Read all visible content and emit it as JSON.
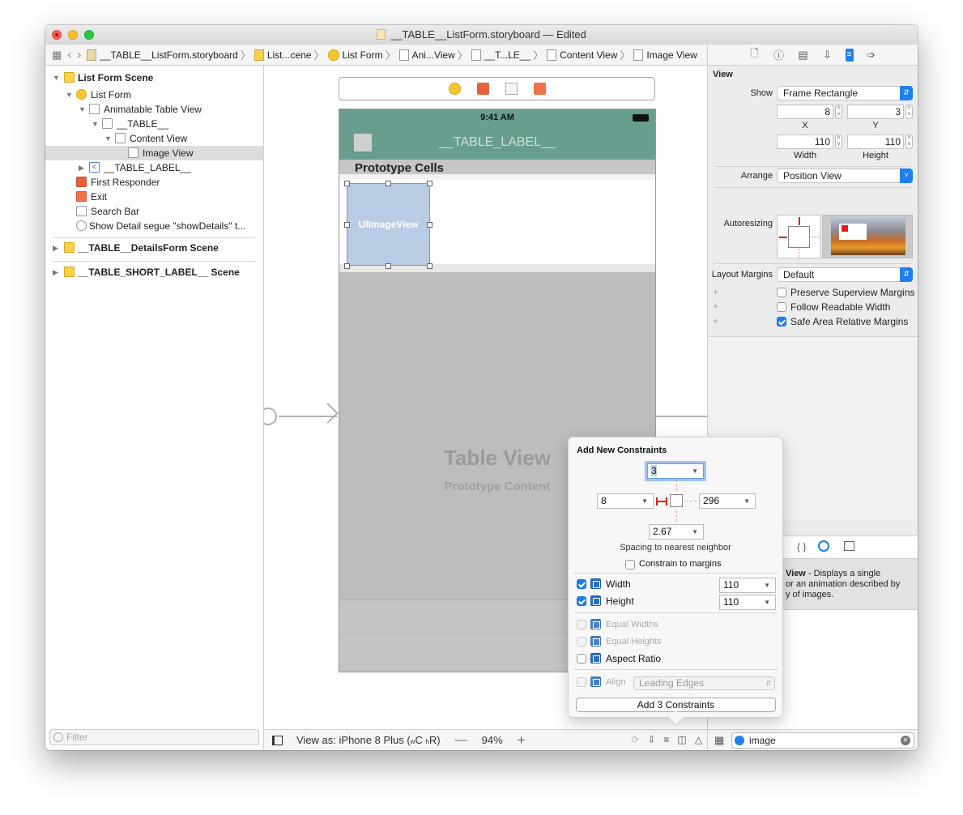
{
  "window": {
    "title": "__TABLE__ListForm.storyboard — Edited"
  },
  "pathbar": {
    "crumbs": [
      {
        "label": "__TABLE__ListForm.storyboard",
        "icon": "storyboard-file-icon"
      },
      {
        "label": "List...cene",
        "icon": "scene-icon"
      },
      {
        "label": "List Form",
        "icon": "view-controller-icon"
      },
      {
        "label": "Ani...View",
        "icon": "table-view-icon"
      },
      {
        "label": "__T...LE__",
        "icon": "table-cell-icon"
      },
      {
        "label": "Content View",
        "icon": "view-icon"
      },
      {
        "label": "Image View",
        "icon": "image-view-icon"
      }
    ]
  },
  "outline": {
    "items": [
      {
        "label": "List Form Scene",
        "bold": true
      },
      {
        "label": "List Form"
      },
      {
        "label": "Animatable Table View"
      },
      {
        "label": "__TABLE__"
      },
      {
        "label": "Content View"
      },
      {
        "label": "Image View",
        "selected": true
      },
      {
        "label": "__TABLE_LABEL__"
      },
      {
        "label": "First Responder"
      },
      {
        "label": "Exit"
      },
      {
        "label": "Search Bar"
      },
      {
        "label": "Show Detail segue \"showDetails\" t..."
      },
      {
        "label": "__TABLE__DetailsForm Scene",
        "bold": true
      },
      {
        "label": "__TABLE_SHORT_LABEL__ Scene",
        "bold": true
      }
    ],
    "filter_placeholder": "Filter"
  },
  "canvas": {
    "status_time": "9:41 AM",
    "nav_title": "__TABLE_LABEL__",
    "section_header": "Prototype Cells",
    "image_view_label": "UIImageView",
    "table_view_title": "Table View",
    "table_view_subtitle": "Prototype Content"
  },
  "bottombar": {
    "view_as": "View as: iPhone 8 Plus (",
    "size_class_w": "w",
    "size_class_w_val": "C ",
    "size_class_h": "h",
    "size_class_h_val": "R)",
    "zoom_minus": "—",
    "zoom_level": "94%",
    "zoom_plus": "+"
  },
  "inspector": {
    "section_title": "View",
    "show_label": "Show",
    "show_value": "Frame Rectangle",
    "x_value": "8",
    "x_label": "X",
    "y_value": "3",
    "y_label": "Y",
    "width_value": "110",
    "width_label": "Width",
    "height_value": "110",
    "height_label": "Height",
    "arrange_label": "Arrange",
    "arrange_value": "Position View",
    "autoresizing_label": "Autoresizing",
    "layout_margins_label": "Layout Margins",
    "layout_margins_value": "Default",
    "checkboxes": [
      {
        "label": "Preserve Superview Margins",
        "checked": false
      },
      {
        "label": "Follow Readable Width",
        "checked": false
      },
      {
        "label": "Safe Area Relative Margins",
        "checked": true
      }
    ]
  },
  "library": {
    "description_bold": "View",
    "description_lines": [
      " - Displays a single",
      "or an animation described by",
      "y of images."
    ],
    "search_value": "image"
  },
  "constraints_popover": {
    "title": "Add New Constraints",
    "top": "3",
    "left": "8",
    "right": "296",
    "bottom": "2.67",
    "spacing_caption": "Spacing to nearest neighbor",
    "constrain_to_margins": {
      "label": "Constrain to margins",
      "checked": false
    },
    "width": {
      "label": "Width",
      "checked": true,
      "value": "110"
    },
    "height": {
      "label": "Height",
      "checked": true,
      "value": "110"
    },
    "equal_widths": {
      "label": "Equal Widths",
      "checked": false,
      "enabled": false
    },
    "equal_heights": {
      "label": "Equal Heights",
      "checked": false,
      "enabled": false
    },
    "aspect_ratio": {
      "label": "Aspect Ratio",
      "checked": false,
      "enabled": true
    },
    "align": {
      "label": "Align",
      "value": "Leading Edges",
      "enabled": false
    },
    "add_button": "Add 3 Constraints"
  },
  "colors": {
    "accent": "#1f7ff0",
    "nav_bar": "#679e8f",
    "image_view_fill": "#b8cce4",
    "constraint_red": "#e41b1b"
  }
}
